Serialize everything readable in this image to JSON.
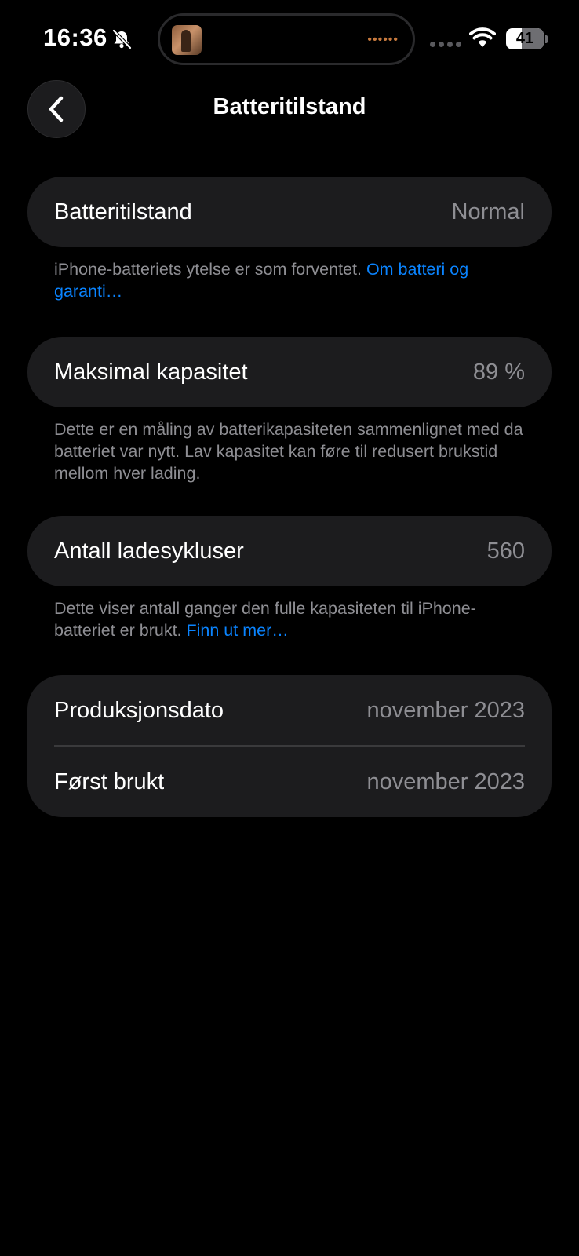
{
  "status_bar": {
    "time": "16:36",
    "battery_level": "41",
    "battery_fraction": 0.41,
    "icons": [
      "bell-slash-icon",
      "cellular-signal-icon",
      "wifi-icon",
      "battery-icon"
    ]
  },
  "nav": {
    "title": "Batteritilstand",
    "back_icon": "chevron-left-icon"
  },
  "sections": {
    "health": {
      "label": "Batteritilstand",
      "value": "Normal",
      "footnote_text": "iPhone-batteriets ytelse er som forventet. ",
      "footnote_link": "Om batteri og garanti…"
    },
    "capacity": {
      "label": "Maksimal kapasitet",
      "value": "89 %",
      "footnote_text": "Dette er en måling av batterikapasiteten sammenlignet med da batteriet var nytt. Lav kapasitet kan føre til redusert brukstid mellom hver lading."
    },
    "cycles": {
      "label": "Antall ladesykluser",
      "value": "560",
      "footnote_text": "Dette viser antall ganger den fulle kapasiteten til iPhone-batteriet er brukt. ",
      "footnote_link": "Finn ut mer…"
    },
    "dates": {
      "manufacture_label": "Produksjonsdato",
      "manufacture_value": "november 2023",
      "first_use_label": "Først brukt",
      "first_use_value": "november 2023"
    }
  },
  "colors": {
    "background": "#000000",
    "card": "#1c1c1e",
    "secondary_text": "#8e8e93",
    "link": "#0a84ff"
  }
}
